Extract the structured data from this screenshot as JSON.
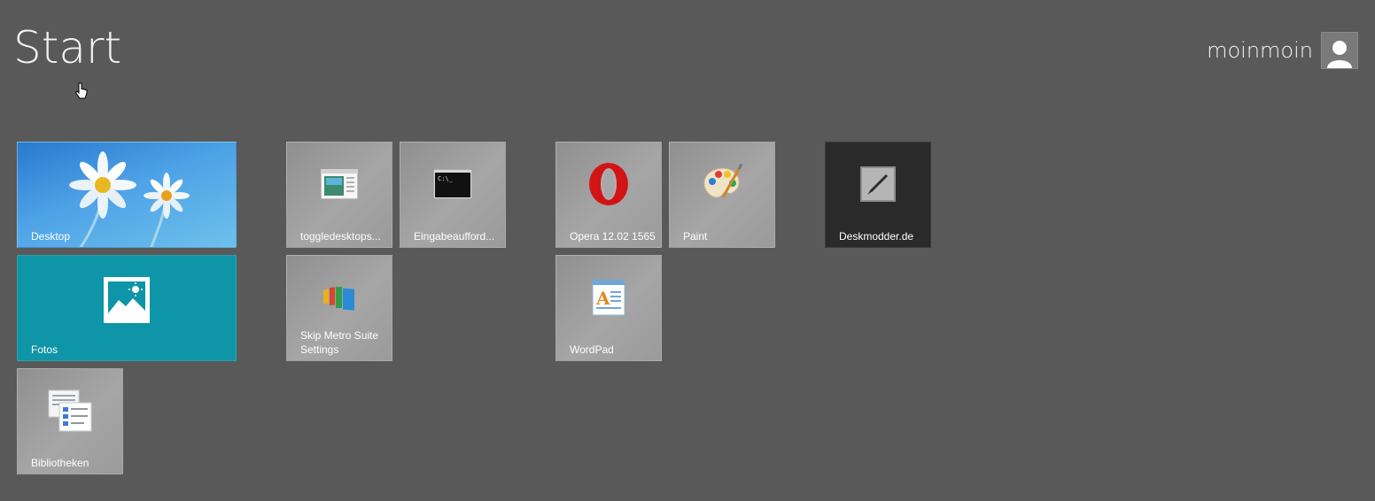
{
  "screen": {
    "title": "Start"
  },
  "user": {
    "name": "moinmoin"
  },
  "tiles": {
    "desktop": {
      "label": "Desktop"
    },
    "fotos": {
      "label": "Fotos"
    },
    "bibliotheken": {
      "label": "Bibliotheken"
    },
    "toggledesktop": {
      "label": "toggledesktops..."
    },
    "eingabe": {
      "label": "Eingabeaufford..."
    },
    "skipmetro": {
      "label": "Skip Metro Suite Settings"
    },
    "opera": {
      "label": "Opera 12.02 1565"
    },
    "paint": {
      "label": "Paint"
    },
    "wordpad": {
      "label": "WordPad"
    },
    "deskmodder": {
      "label": "Deskmodder.de"
    }
  },
  "colors": {
    "background": "#595959",
    "tile_gray": "#9a9a9a",
    "tile_teal": "#0e95a7",
    "tile_dark": "#2a2a2a",
    "desktop_blue": "#4ea2e6"
  },
  "icons": {
    "desktop": "daisy-wallpaper-icon",
    "fotos": "photo-icon",
    "bibliotheken": "libraries-icon",
    "toggledesktop": "window-icon",
    "eingabe": "command-prompt-icon",
    "skipmetro": "skip-metro-icon",
    "opera": "opera-icon",
    "paint": "paint-palette-icon",
    "wordpad": "wordpad-icon",
    "deskmodder": "brush-icon",
    "user": "user-avatar-icon",
    "cursor": "hand-cursor-icon"
  }
}
